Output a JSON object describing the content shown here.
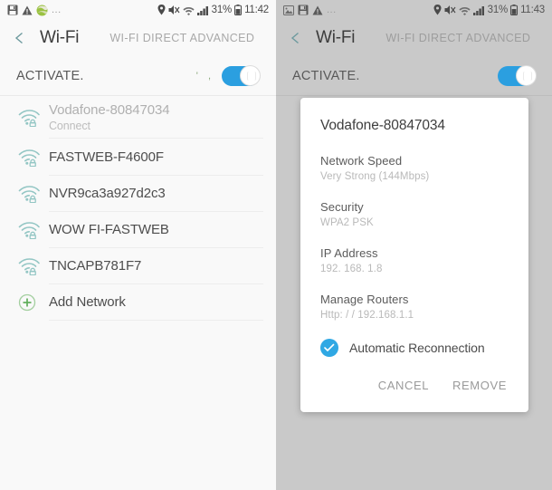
{
  "left": {
    "status_bar": {
      "icons": [
        "save-icon",
        "warning-triangle-icon",
        "globe-icon"
      ],
      "overflow": "...",
      "right_icons": [
        "location-pin-icon",
        "mute-icon",
        "wifi-icon",
        "signal-bars-icon"
      ],
      "battery": "31%",
      "time": "11:42"
    },
    "action_bar": {
      "back": "back-chevron-icon",
      "title": "Wi-Fi",
      "actions": "WI-FI DIRECT ADVANCED"
    },
    "activate": {
      "label": "ACTIVATE.",
      "hint": "' ,",
      "toggle_on": true
    },
    "networks": [
      {
        "ssid": "Vodafone-80847034",
        "sub": "Connect",
        "dim": true,
        "icon": "wifi-lock-icon"
      },
      {
        "ssid": "FASTWEB-F4600F",
        "sub": "",
        "dim": false,
        "icon": "wifi-lock-icon"
      },
      {
        "ssid": "NVR9ca3a927d2c3",
        "sub": "",
        "dim": false,
        "icon": "wifi-lock-icon"
      },
      {
        "ssid": "WOW FI-FASTWEB",
        "sub": "",
        "dim": false,
        "icon": "wifi-lock-icon"
      },
      {
        "ssid": "TNCAPB781F7",
        "sub": "",
        "dim": false,
        "icon": "wifi-lock-icon"
      }
    ],
    "add_network": {
      "label": "Add Network",
      "icon": "plus-circle-icon"
    }
  },
  "right": {
    "status_bar": {
      "icons": [
        "image-icon",
        "save-icon",
        "warning-triangle-icon"
      ],
      "overflow": "...",
      "right_icons": [
        "location-pin-icon",
        "mute-icon",
        "wifi-icon",
        "signal-bars-icon"
      ],
      "battery": "31%",
      "time": "11:43"
    },
    "action_bar": {
      "back": "back-chevron-icon",
      "title": "Wi-Fi",
      "actions": "WI-FI DIRECT ADVANCED"
    },
    "activate": {
      "label": "ACTIVATE.",
      "toggle_on": true
    },
    "dialog": {
      "title": "Vodafone-80847034",
      "fields": [
        {
          "label": "Network Speed",
          "value": "Very Strong (144Mbps)"
        },
        {
          "label": "Security",
          "value": "WPA2 PSK"
        },
        {
          "label": "IP Address",
          "value": "192. 168. 1.8"
        },
        {
          "label": "Manage Routers",
          "value": "Http: / / 192.168.1.1"
        }
      ],
      "checkbox": {
        "label": "Automatic Reconnection",
        "checked": true
      },
      "cancel_label": "CANCEL",
      "remove_label": "REMOVE"
    }
  },
  "colors": {
    "accent_blue": "#2b9fe0",
    "wifi_icon_teal": "#8fc5c3",
    "add_green": "#6cb86c",
    "scrim_grey": "#c9c9c9",
    "panel_bg": "#f9f9f9"
  }
}
